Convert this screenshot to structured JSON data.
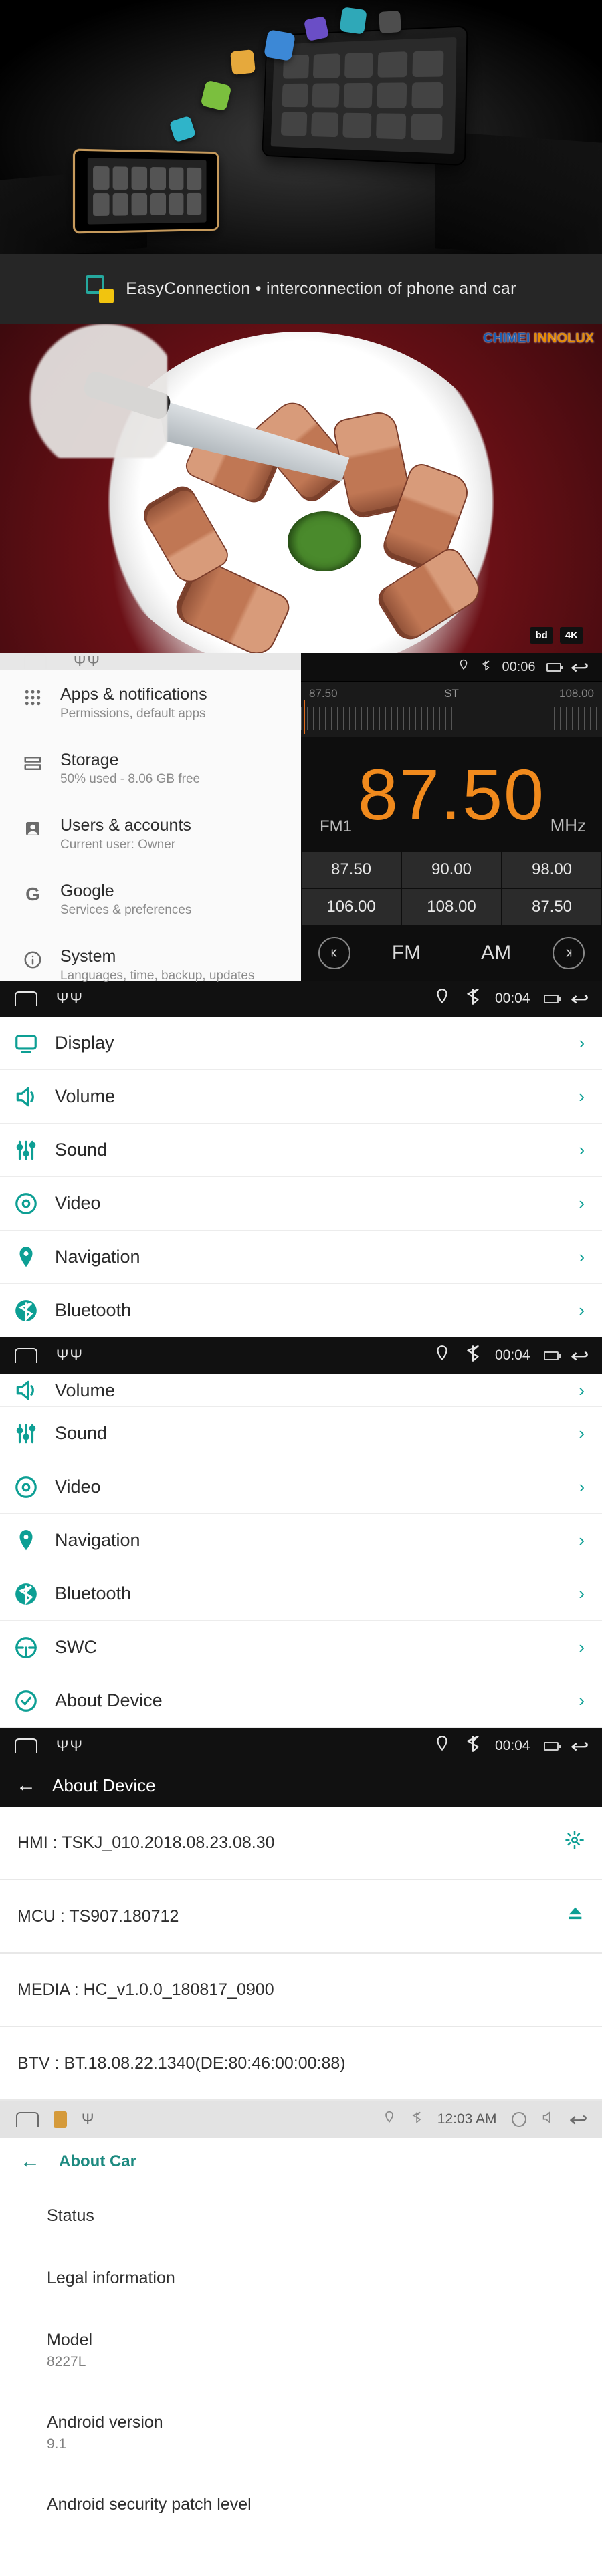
{
  "promo": {
    "tagline": "EasyConnection • interconnection of phone and car"
  },
  "video": {
    "watermark_a": "CHIMEI",
    "watermark_b": "INNOLUX",
    "badge1": "bd",
    "badge2": "4K"
  },
  "status": {
    "radio_time": "00:06",
    "bar_time": "00:04",
    "light_time": "12:03 AM"
  },
  "android_settings": [
    {
      "title": "Apps & notifications",
      "sub": "Permissions, default apps",
      "icon": "apps"
    },
    {
      "title": "Storage",
      "sub": "50% used - 8.06 GB free",
      "icon": "storage"
    },
    {
      "title": "Users & accounts",
      "sub": "Current user: Owner",
      "icon": "user"
    },
    {
      "title": "Google",
      "sub": "Services & preferences",
      "icon": "google"
    },
    {
      "title": "System",
      "sub": "Languages, time, backup, updates",
      "icon": "info"
    }
  ],
  "radio": {
    "scale_min": "87.50",
    "scale_max": "108.00",
    "stereo": "ST",
    "band": "FM1",
    "freq": "87.50",
    "unit": "MHz",
    "presets": [
      "87.50",
      "90.00",
      "98.00",
      "106.00",
      "108.00",
      "87.50"
    ],
    "modes": {
      "fm": "FM",
      "am": "AM"
    }
  },
  "menu1": [
    {
      "label": "Display",
      "icon": "display"
    },
    {
      "label": "Volume",
      "icon": "volume"
    },
    {
      "label": "Sound",
      "icon": "equalizer"
    },
    {
      "label": "Video",
      "icon": "video"
    },
    {
      "label": "Navigation",
      "icon": "pin"
    },
    {
      "label": "Bluetooth",
      "icon": "bluetooth"
    }
  ],
  "menu2": [
    {
      "label": "Volume",
      "icon": "volume"
    },
    {
      "label": "Sound",
      "icon": "equalizer"
    },
    {
      "label": "Video",
      "icon": "video"
    },
    {
      "label": "Navigation",
      "icon": "pin"
    },
    {
      "label": "Bluetooth",
      "icon": "bluetooth"
    },
    {
      "label": "SWC",
      "icon": "swc"
    },
    {
      "label": "About Device",
      "icon": "about"
    }
  ],
  "about_device": {
    "title": "About Device",
    "rows": [
      {
        "text": "HMI : TSKJ_010.2018.08.23.08.30",
        "action": "gear"
      },
      {
        "text": "MCU : TS907.180712",
        "action": "eject"
      },
      {
        "text": "MEDIA : HC_v1.0.0_180817_0900",
        "action": ""
      },
      {
        "text": "BTV : BT.18.08.22.1340(DE:80:46:00:00:88)",
        "action": ""
      }
    ]
  },
  "about_car": {
    "title": "About Car",
    "items": [
      {
        "h": "Status",
        "v": ""
      },
      {
        "h": "Legal information",
        "v": ""
      },
      {
        "h": "Model",
        "v": "8227L"
      },
      {
        "h": "Android version",
        "v": "9.1"
      },
      {
        "h": "Android security patch level",
        "v": ""
      }
    ]
  }
}
